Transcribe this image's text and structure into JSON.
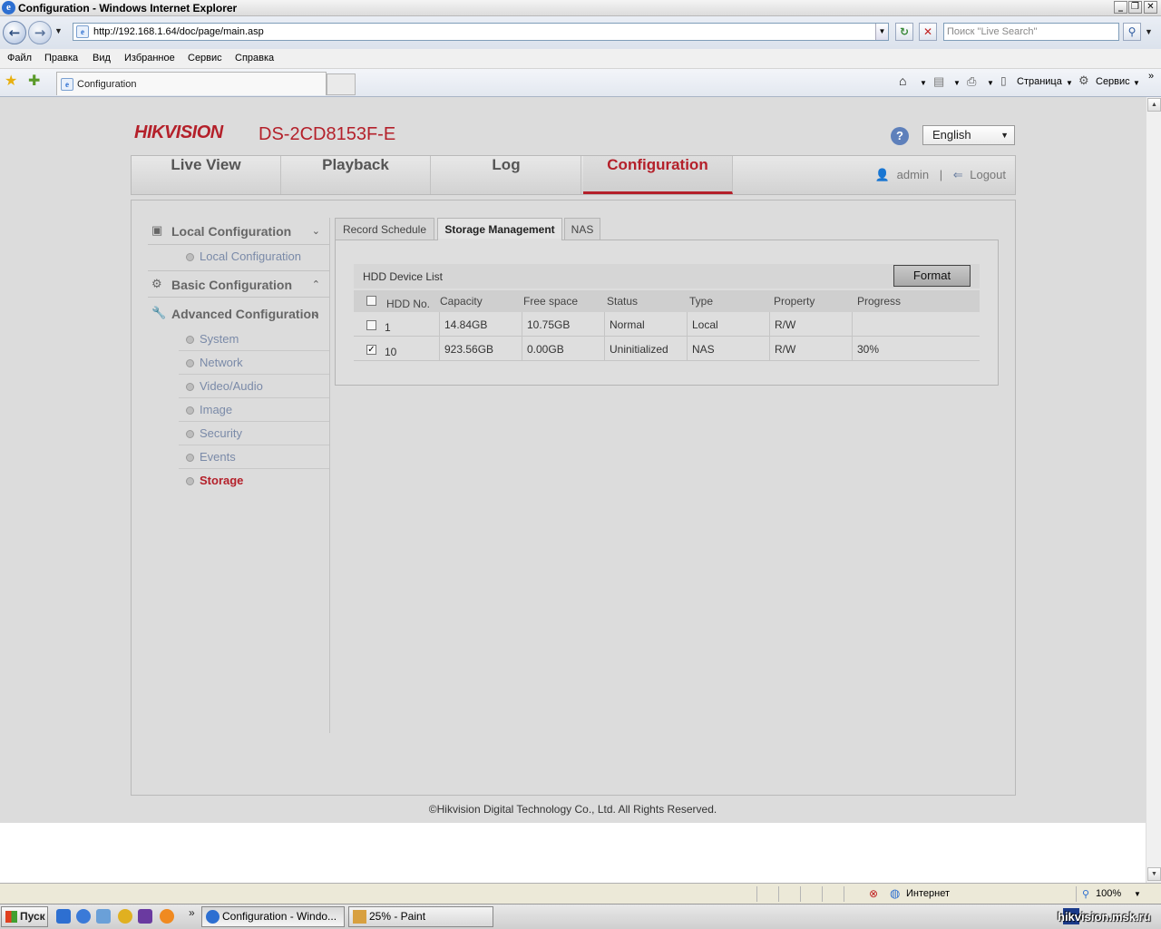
{
  "window": {
    "title": "Configuration - Windows Internet Explorer"
  },
  "address": {
    "url": "http://192.168.1.64/doc/page/main.asp",
    "search_placeholder": "Поиск \"Live Search\""
  },
  "menu": [
    "Файл",
    "Правка",
    "Вид",
    "Избранное",
    "Сервис",
    "Справка"
  ],
  "browser_tab": {
    "title": "Configuration"
  },
  "command_bar": {
    "page": "Страница",
    "tools": "Сервис"
  },
  "header": {
    "logo": "HIKVISION",
    "model": "DS-2CD8153F-E",
    "help": "?",
    "language": "English"
  },
  "nav": {
    "tabs": [
      "Live View",
      "Playback",
      "Log",
      "Configuration"
    ],
    "active": "Configuration",
    "user": "admin",
    "separator": "|",
    "logout": "Logout"
  },
  "sidebar": {
    "local": {
      "label": "Local Configuration",
      "items": [
        "Local Configuration"
      ]
    },
    "basic": {
      "label": "Basic Configuration"
    },
    "advanced": {
      "label": "Advanced Configuration",
      "items": [
        "System",
        "Network",
        "Video/Audio",
        "Image",
        "Security",
        "Events",
        "Storage"
      ]
    },
    "active": "Storage"
  },
  "content": {
    "tabs": [
      "Record Schedule",
      "Storage Management",
      "NAS"
    ],
    "active_tab": "Storage Management",
    "hdd_list_title": "HDD Device List",
    "format_button": "Format",
    "columns": [
      "HDD No.",
      "Capacity",
      "Free space",
      "Status",
      "Type",
      "Property",
      "Progress"
    ],
    "rows": [
      {
        "checked": false,
        "no": "1",
        "capacity": "14.84GB",
        "free": "10.75GB",
        "status": "Normal",
        "type": "Local",
        "property": "R/W",
        "progress": ""
      },
      {
        "checked": true,
        "no": "10",
        "capacity": "923.56GB",
        "free": "0.00GB",
        "status": "Uninitialized",
        "type": "NAS",
        "property": "R/W",
        "progress": "30%"
      }
    ]
  },
  "footer": {
    "copyright": "©Hikvision Digital Technology Co., Ltd. All Rights Reserved."
  },
  "statusbar": {
    "zone": "Интернет",
    "zoom": "100%"
  },
  "taskbar": {
    "start": "Пуск",
    "tasks": [
      "Configuration - Windo...",
      "25% - Paint"
    ]
  },
  "watermark": "hikvision.msk.ru"
}
